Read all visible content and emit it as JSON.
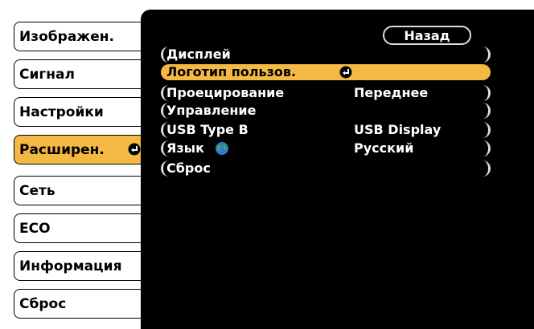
{
  "sidebar": {
    "items": [
      {
        "label": "Изображен.",
        "active": false
      },
      {
        "label": "Сигнал",
        "active": false
      },
      {
        "label": "Настройки",
        "active": false
      },
      {
        "label": "Расширен.",
        "active": true
      },
      {
        "label": "Сеть",
        "active": false
      },
      {
        "label": "ECO",
        "active": false
      },
      {
        "label": "Информация",
        "active": false
      },
      {
        "label": "Сброс",
        "active": false
      }
    ]
  },
  "panel": {
    "back_label": "Назад",
    "rows": [
      {
        "label": "Дисплей",
        "value": ""
      },
      {
        "label": "Логотип пользов.",
        "value": "",
        "active": true
      },
      {
        "label": "Проецирование",
        "value": "Переднее"
      },
      {
        "label": "Управление",
        "value": ""
      },
      {
        "label": "USB Type B",
        "value": "USB Display"
      },
      {
        "label": "Язык",
        "value": "Русский"
      },
      {
        "label": "Сброс",
        "value": ""
      }
    ]
  },
  "colors": {
    "accent": "#f4b942",
    "panel": "#000000",
    "text_light": "#ffffff"
  },
  "icons": {
    "enter": "enter-icon",
    "language": "globe-icon"
  }
}
